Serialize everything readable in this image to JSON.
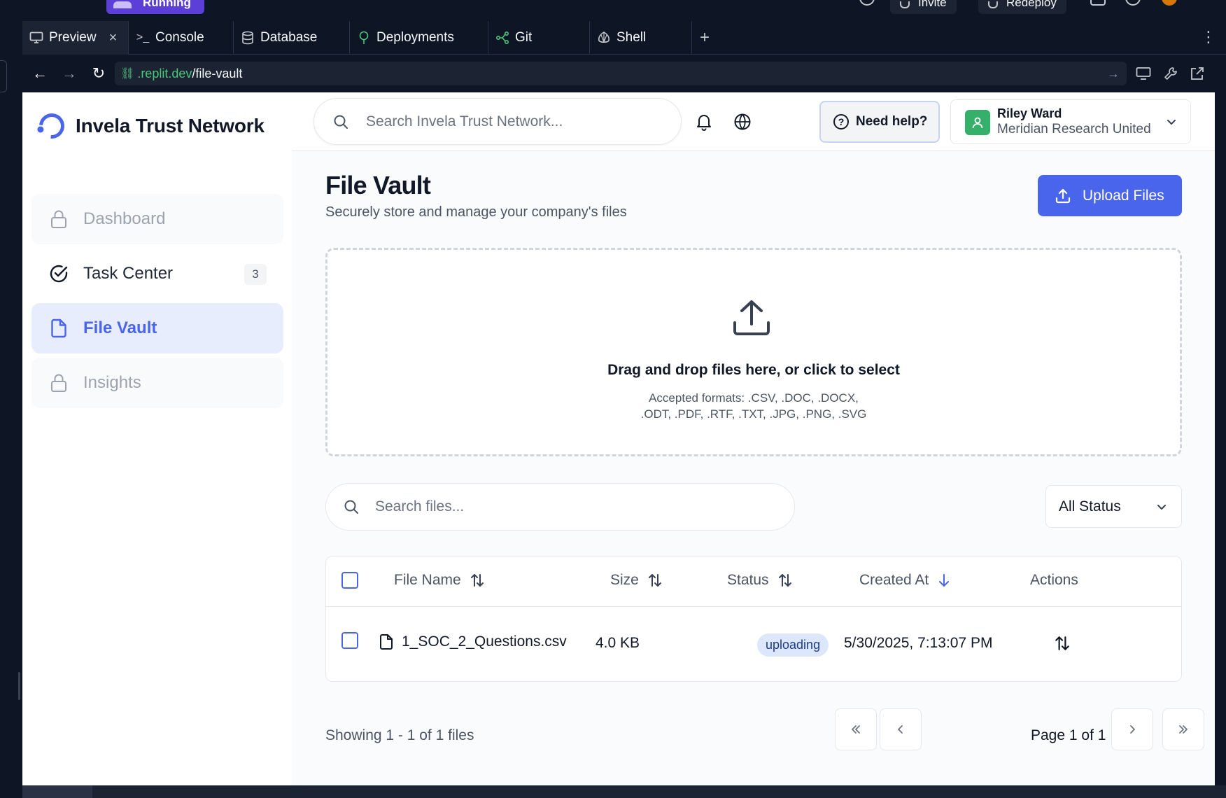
{
  "ide": {
    "running_label": "Running",
    "invite_label": "Invite",
    "redeploy_label": "Redeploy",
    "tabs": [
      {
        "label": "Preview",
        "icon": "monitor-icon",
        "active": true
      },
      {
        "label": "Console",
        "icon": "terminal-icon"
      },
      {
        "label": "Database",
        "icon": "database-icon"
      },
      {
        "label": "Deployments",
        "icon": "deploy-icon"
      },
      {
        "label": "Git",
        "icon": "git-icon"
      },
      {
        "label": "Shell",
        "icon": "shell-icon"
      }
    ],
    "url": {
      "host": ".replit.dev",
      "path": "/file-vault"
    }
  },
  "app": {
    "brand_name": "Invela Trust Network",
    "colors": {
      "accent": "#4965ec",
      "active_bg": "#e8edfd",
      "pill_bg": "#dde7fb"
    },
    "sidebar": {
      "items": [
        {
          "label": "Dashboard",
          "icon": "lock-icon",
          "state": "locked"
        },
        {
          "label": "Task Center",
          "icon": "check-circle-icon",
          "state": "normal",
          "badge": "3"
        },
        {
          "label": "File Vault",
          "icon": "file-icon",
          "state": "active"
        },
        {
          "label": "Insights",
          "icon": "lock-icon",
          "state": "locked"
        }
      ]
    },
    "header": {
      "search_placeholder": "Search Invela Trust Network...",
      "help_label": "Need help?",
      "user_name": "Riley Ward",
      "user_org": "Meridian Research United"
    },
    "page": {
      "title": "File Vault",
      "subtitle": "Securely store and manage your company's files",
      "upload_button": "Upload Files"
    },
    "dropzone": {
      "title": "Drag and drop files here, or click to select",
      "formats_line1": "Accepted formats: .CSV, .DOC, .DOCX,",
      "formats_line2": ".ODT, .PDF, .RTF, .TXT, .JPG, .PNG, .SVG"
    },
    "filters": {
      "search_placeholder": "Search files...",
      "status_selected": "All Status"
    },
    "table": {
      "columns": {
        "name": "File Name",
        "size": "Size",
        "status": "Status",
        "created": "Created At",
        "actions": "Actions"
      },
      "rows": [
        {
          "name": "1_SOC_2_Questions.csv",
          "size": "4.0 KB",
          "status": "uploading",
          "created": "5/30/2025, 7:13:07 PM"
        }
      ]
    },
    "pagination": {
      "showing": "Showing 1 - 1 of 1 files",
      "page_text": "Page 1 of 1"
    }
  }
}
